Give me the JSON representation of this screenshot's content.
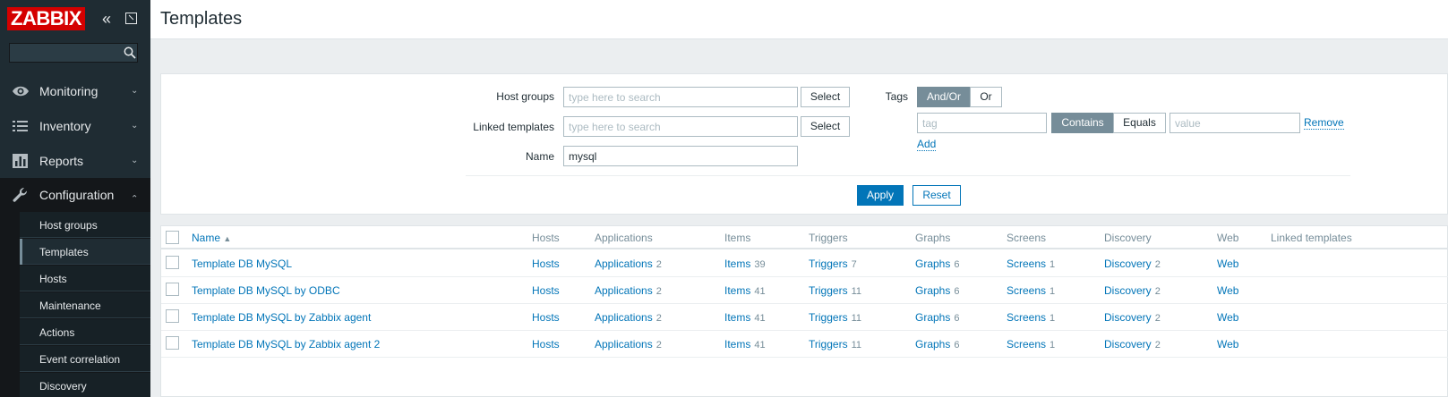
{
  "app": {
    "logo": "ZABBIX",
    "collapse_glyph": "«"
  },
  "colors": {
    "brand": "#d40000",
    "sidebar_bg": "#1f2c33",
    "link": "#0275b8",
    "primary_button": "#0275b8",
    "segment_active": "#768d99"
  },
  "sidebar": {
    "nav": [
      {
        "label": "Monitoring",
        "icon": "eye-icon",
        "expanded": false
      },
      {
        "label": "Inventory",
        "icon": "list-icon",
        "expanded": false
      },
      {
        "label": "Reports",
        "icon": "bar-chart-icon",
        "expanded": false
      },
      {
        "label": "Configuration",
        "icon": "wrench-icon",
        "expanded": true
      }
    ],
    "submenu": [
      {
        "label": "Host groups"
      },
      {
        "label": "Templates",
        "selected": true
      },
      {
        "label": "Hosts"
      },
      {
        "label": "Maintenance"
      },
      {
        "label": "Actions"
      },
      {
        "label": "Event correlation"
      },
      {
        "label": "Discovery"
      }
    ]
  },
  "header": {
    "title": "Templates"
  },
  "filter": {
    "host_groups": {
      "label": "Host groups",
      "placeholder": "type here to search",
      "button": "Select"
    },
    "linked_templates": {
      "label": "Linked templates",
      "placeholder": "type here to search",
      "button": "Select"
    },
    "name": {
      "label": "Name",
      "value": "mysql"
    },
    "tags": {
      "label": "Tags",
      "operator_options": [
        "And/Or",
        "Or"
      ],
      "operator_selected": "And/Or",
      "tag_placeholder": "tag",
      "match_options": [
        "Contains",
        "Equals"
      ],
      "match_selected": "Contains",
      "value_placeholder": "value",
      "remove": "Remove",
      "add": "Add"
    },
    "apply": "Apply",
    "reset": "Reset"
  },
  "table": {
    "columns": [
      "Name",
      "Hosts",
      "Applications",
      "Items",
      "Triggers",
      "Graphs",
      "Screens",
      "Discovery",
      "Web",
      "Linked templates"
    ],
    "sort_indicator": "▲",
    "rows": [
      {
        "name": "Template DB MySQL",
        "hosts": "Hosts",
        "applications": "Applications",
        "applications_count": "2",
        "items": "Items",
        "items_count": "39",
        "triggers": "Triggers",
        "triggers_count": "7",
        "graphs": "Graphs",
        "graphs_count": "6",
        "screens": "Screens",
        "screens_count": "1",
        "discovery": "Discovery",
        "discovery_count": "2",
        "web": "Web"
      },
      {
        "name": "Template DB MySQL by ODBC",
        "hosts": "Hosts",
        "applications": "Applications",
        "applications_count": "2",
        "items": "Items",
        "items_count": "41",
        "triggers": "Triggers",
        "triggers_count": "11",
        "graphs": "Graphs",
        "graphs_count": "6",
        "screens": "Screens",
        "screens_count": "1",
        "discovery": "Discovery",
        "discovery_count": "2",
        "web": "Web"
      },
      {
        "name": "Template DB MySQL by Zabbix agent",
        "hosts": "Hosts",
        "applications": "Applications",
        "applications_count": "2",
        "items": "Items",
        "items_count": "41",
        "triggers": "Triggers",
        "triggers_count": "11",
        "graphs": "Graphs",
        "graphs_count": "6",
        "screens": "Screens",
        "screens_count": "1",
        "discovery": "Discovery",
        "discovery_count": "2",
        "web": "Web"
      },
      {
        "name": "Template DB MySQL by Zabbix agent 2",
        "hosts": "Hosts",
        "applications": "Applications",
        "applications_count": "2",
        "items": "Items",
        "items_count": "41",
        "triggers": "Triggers",
        "triggers_count": "11",
        "graphs": "Graphs",
        "graphs_count": "6",
        "screens": "Screens",
        "screens_count": "1",
        "discovery": "Discovery",
        "discovery_count": "2",
        "web": "Web"
      }
    ]
  }
}
